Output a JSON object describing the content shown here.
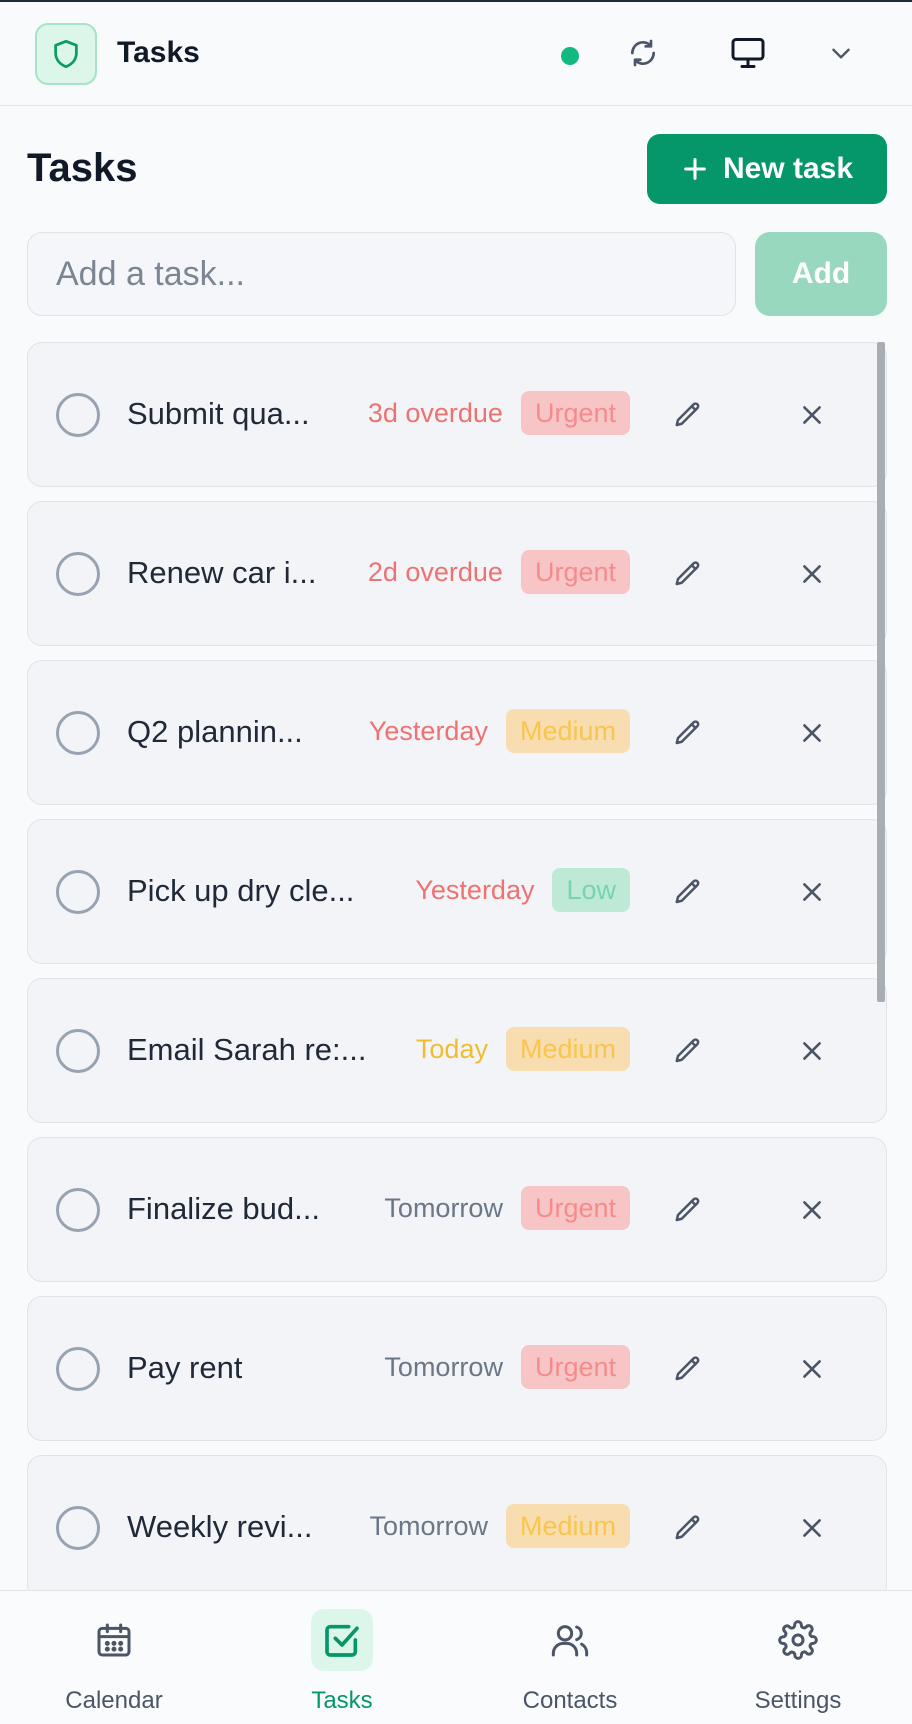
{
  "app": {
    "title": "Tasks",
    "logo_icon": "shield-icon",
    "status": "online",
    "status_color": "#12b981"
  },
  "header_actions": {
    "sync_icon": "refresh-icon",
    "display_icon": "monitor-icon",
    "menu_icon": "chevron-down-icon"
  },
  "page": {
    "title": "Tasks",
    "new_task_label": "New task"
  },
  "add_task": {
    "placeholder": "Add a task...",
    "value": "",
    "button_label": "Add"
  },
  "tasks": [
    {
      "title": "Submit qua...",
      "due": "3d overdue",
      "due_state": "overdue",
      "priority": "Urgent",
      "priority_level": "urgent",
      "completed": false
    },
    {
      "title": "Renew car i...",
      "due": "2d overdue",
      "due_state": "overdue",
      "priority": "Urgent",
      "priority_level": "urgent",
      "completed": false
    },
    {
      "title": "Q2 plannin...",
      "due": "Yesterday",
      "due_state": "overdue",
      "priority": "Medium",
      "priority_level": "medium",
      "completed": false
    },
    {
      "title": "Pick up dry cle...",
      "due": "Yesterday",
      "due_state": "overdue",
      "priority": "Low",
      "priority_level": "low",
      "completed": false
    },
    {
      "title": "Email Sarah re:...",
      "due": "Today",
      "due_state": "today",
      "priority": "Medium",
      "priority_level": "medium",
      "completed": false
    },
    {
      "title": "Finalize bud...",
      "due": "Tomorrow",
      "due_state": "future",
      "priority": "Urgent",
      "priority_level": "urgent",
      "completed": false
    },
    {
      "title": "Pay rent",
      "due": "Tomorrow",
      "due_state": "future",
      "priority": "Urgent",
      "priority_level": "urgent",
      "completed": false
    },
    {
      "title": "Weekly revi...",
      "due": "Tomorrow",
      "due_state": "future",
      "priority": "Medium",
      "priority_level": "medium",
      "completed": false
    }
  ],
  "nav": [
    {
      "label": "Calendar",
      "icon": "calendar-icon",
      "active": false
    },
    {
      "label": "Tasks",
      "icon": "tasks-icon",
      "active": true
    },
    {
      "label": "Contacts",
      "icon": "contacts-icon",
      "active": false
    },
    {
      "label": "Settings",
      "icon": "settings-icon",
      "active": false
    }
  ],
  "colors": {
    "accent": "#059669",
    "overdue": "#ee7272",
    "today": "#f0bd2f",
    "muted": "#6b7686"
  }
}
